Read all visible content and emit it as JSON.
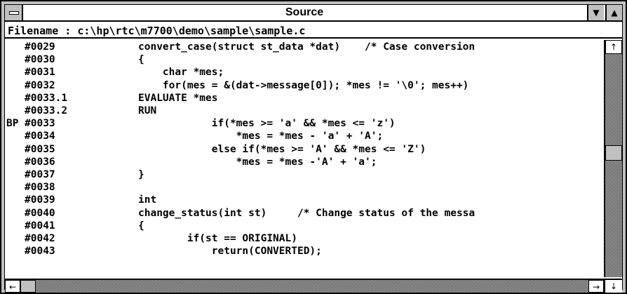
{
  "window": {
    "title": "Source",
    "min_glyph": "▼",
    "max_glyph": "▲"
  },
  "filename": {
    "label": "Filename : c:\\hp\\rtc\\m7700\\demo\\sample\\sample.c"
  },
  "code_lines": [
    {
      "bp": "",
      "num": "#0029",
      "src": "convert_case(struct st_data *dat)    /* Case conversion"
    },
    {
      "bp": "",
      "num": "#0030",
      "src": "{"
    },
    {
      "bp": "",
      "num": "#0031",
      "src": "    char *mes;"
    },
    {
      "bp": "",
      "num": "#0032",
      "src": "    for(mes = &(dat->message[0]); *mes != '\\0'; mes++)"
    },
    {
      "bp": "",
      "num": "#0033.1",
      "src": "EVALUATE *mes"
    },
    {
      "bp": "",
      "num": "#0033.2",
      "src": "RUN"
    },
    {
      "bp": "BP",
      "num": "#0033",
      "src": "            if(*mes >= 'a' && *mes <= 'z')"
    },
    {
      "bp": "",
      "num": "#0034",
      "src": "                *mes = *mes - 'a' + 'A';"
    },
    {
      "bp": "",
      "num": "#0035",
      "src": "            else if(*mes >= 'A' && *mes <= 'Z')"
    },
    {
      "bp": "",
      "num": "#0036",
      "src": "                *mes = *mes -'A' + 'a';"
    },
    {
      "bp": "",
      "num": "#0037",
      "src": "}"
    },
    {
      "bp": "",
      "num": "#0038",
      "src": ""
    },
    {
      "bp": "",
      "num": "#0039",
      "src": "int"
    },
    {
      "bp": "",
      "num": "#0040",
      "src": "change_status(int st)     /* Change status of the messa"
    },
    {
      "bp": "",
      "num": "#0041",
      "src": "{"
    },
    {
      "bp": "",
      "num": "#0042",
      "src": "        if(st == ORIGINAL)"
    },
    {
      "bp": "",
      "num": "#0043",
      "src": "            return(CONVERTED);"
    }
  ],
  "scrollbars": {
    "up_glyph": "↑",
    "down_glyph": "↓",
    "left_glyph": "←",
    "right_glyph": "→"
  }
}
